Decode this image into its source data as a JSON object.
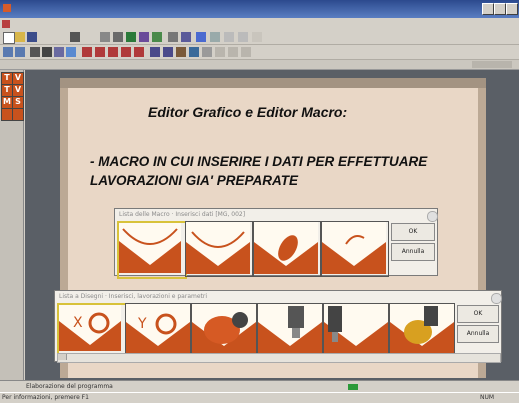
{
  "slide": {
    "title": "Editor Grafico e Editor Macro:",
    "body_line1": "- MACRO IN CUI INSERIRE I DATI PER EFFETTUARE",
    "body_line2": "LAVORAZIONI GIA' PREPARATE"
  },
  "dialog1": {
    "title": "Lista delle Macro · Inserisci dati [MG, 002]",
    "ok_label": "OK",
    "cancel_label": "Annulla",
    "thumbnails": [
      "macro-1",
      "macro-2",
      "macro-3",
      "macro-4"
    ]
  },
  "dialog2": {
    "title": "Lista a Disegni · Inserisci, lavorazioni e parametri",
    "ok_label": "OK",
    "cancel_label": "Annulla",
    "thumbnails": [
      "tool-x",
      "tool-y",
      "tool-3",
      "tool-4",
      "tool-5",
      "tool-6"
    ]
  },
  "statusbar": {
    "text": "Elaborazione del programma",
    "help": "Per informazioni, premere F1",
    "indicator": "NUM"
  },
  "palette": {
    "items": [
      "T",
      "V",
      "T",
      "V",
      "M",
      "S"
    ]
  },
  "colors": {
    "slide_bg": "#e9d7c6",
    "workspace": "#5a5f66",
    "accent": "#c8521d"
  }
}
